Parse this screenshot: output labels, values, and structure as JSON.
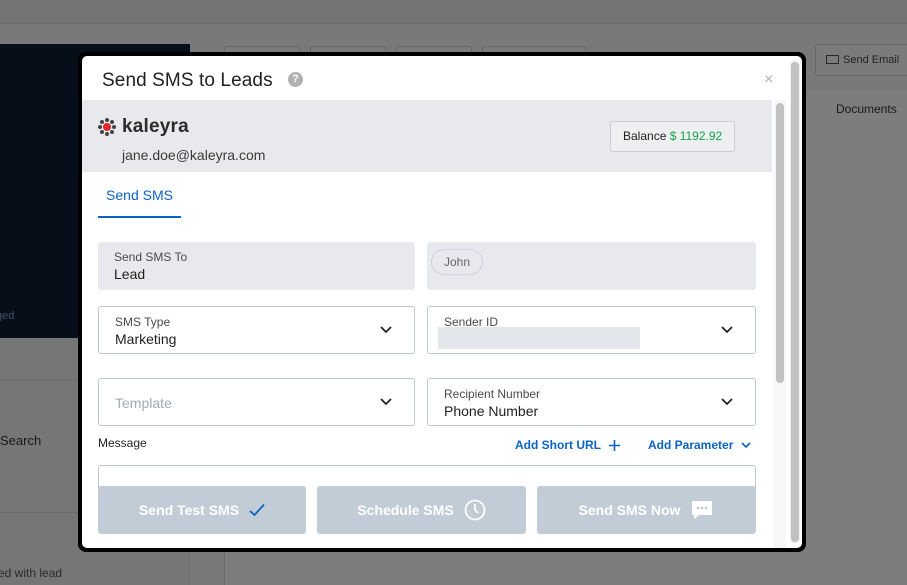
{
  "background": {
    "left_panel_text": "ged",
    "search_label": "Search",
    "with_lead_label": "ed with lead",
    "send_email_label": "Send Email",
    "documents_label": "Documents"
  },
  "modal": {
    "title": "Send SMS to Leads",
    "help_icon": "question-circle-icon",
    "close_label": "×"
  },
  "brand": {
    "logo_text": "kaleyra",
    "user_email": "jane.doe@kaleyra.com",
    "balance_label": "Balance",
    "balance_amount": "$ 1192.92",
    "balance_color": "#16a34a",
    "logo_accent": "#e3262b"
  },
  "tabs": [
    {
      "label": "Send SMS",
      "active": true
    }
  ],
  "form": {
    "send_to": {
      "label": "Send SMS To",
      "value": "Lead"
    },
    "recipient_chip": "John",
    "sms_type": {
      "label": "SMS Type",
      "value": "Marketing"
    },
    "sender_id": {
      "label": "Sender ID",
      "value": ""
    },
    "template": {
      "placeholder": "Template"
    },
    "recipient_number": {
      "label": "Recipient Number",
      "value": "Phone Number"
    },
    "message_label": "Message",
    "add_short_url": "Add Short URL",
    "add_parameter": "Add Parameter"
  },
  "actions": {
    "send_test": "Send Test SMS",
    "schedule": "Schedule SMS",
    "send_now": "Send SMS Now"
  },
  "colors": {
    "accent": "#0b63c5",
    "disabled_button": "#c1ccd7"
  }
}
